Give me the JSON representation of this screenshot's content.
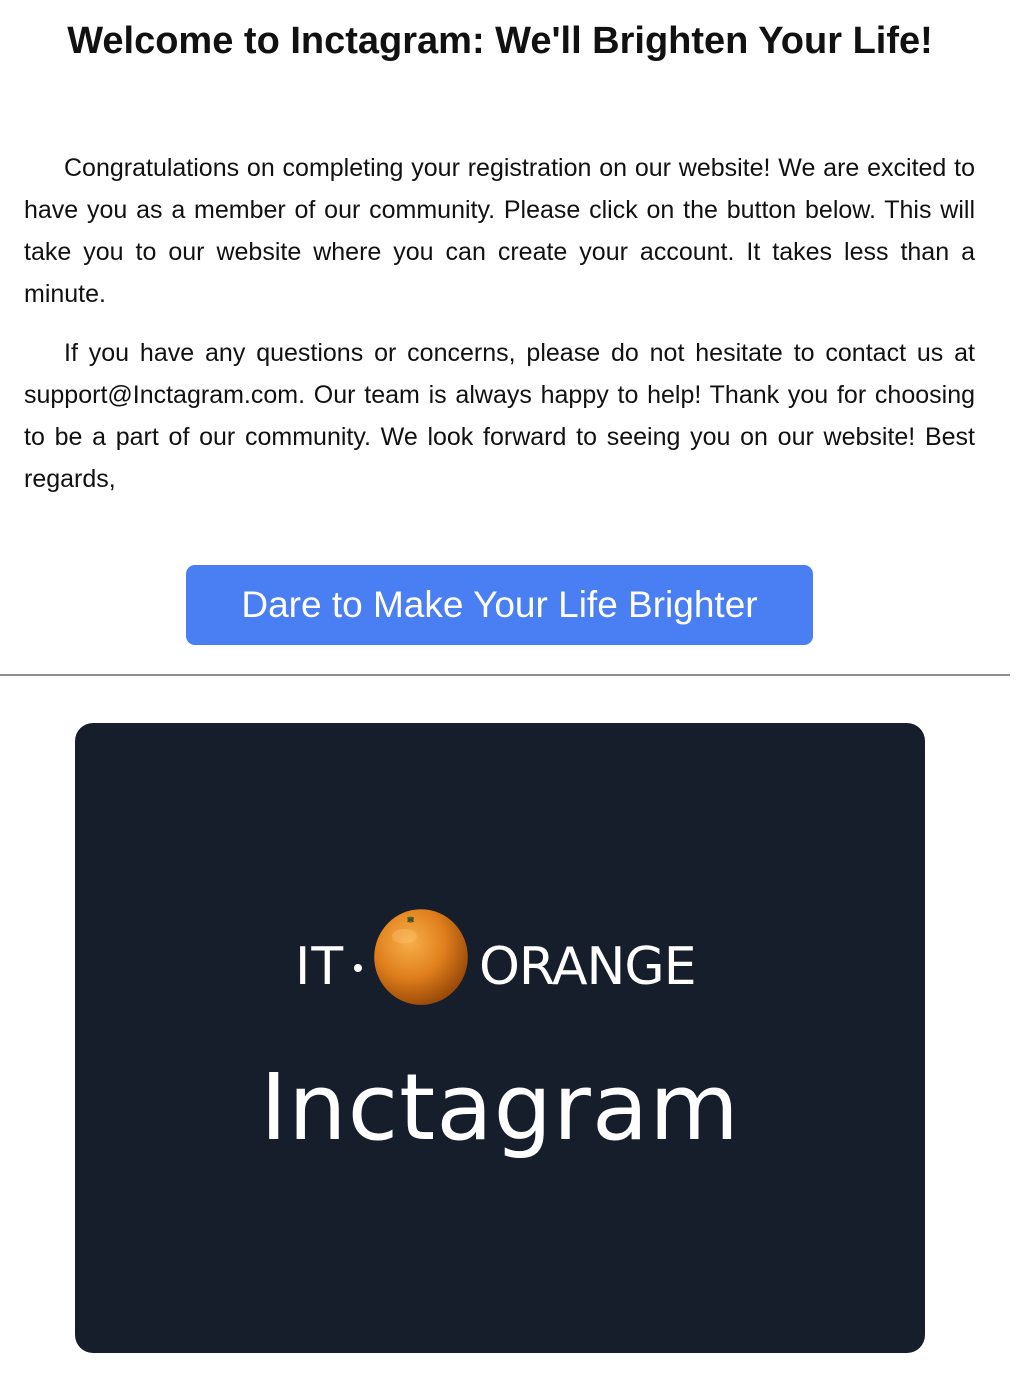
{
  "email": {
    "title": "Welcome to Inctagram: We'll Brighten Your Life!",
    "paragraph_1": "Congratulations on completing your registration on our website! We are excited to have you as a member of our community. Please click on the button below. This will take you to our website where you can create your account. It takes less than a minute.",
    "paragraph_2": "If you have any questions or concerns, please do not hesitate to contact us at support@Inctagram.com. Our team is always happy to help! Thank you for choosing to be a part of our community. We look forward to seeing you on our website! Best regards,",
    "cta_label": "Dare to Make Your Life Brighter"
  },
  "banner": {
    "logo_prefix": "IT",
    "logo_suffix": "ORANGE",
    "logo_icon": "orange-fruit-icon",
    "brand_name": "Inctagram",
    "background_color": "#161e2b"
  },
  "colors": {
    "button": "#4a7ef3",
    "button_text": "#ffffff",
    "divider": "#8f8f8f"
  }
}
